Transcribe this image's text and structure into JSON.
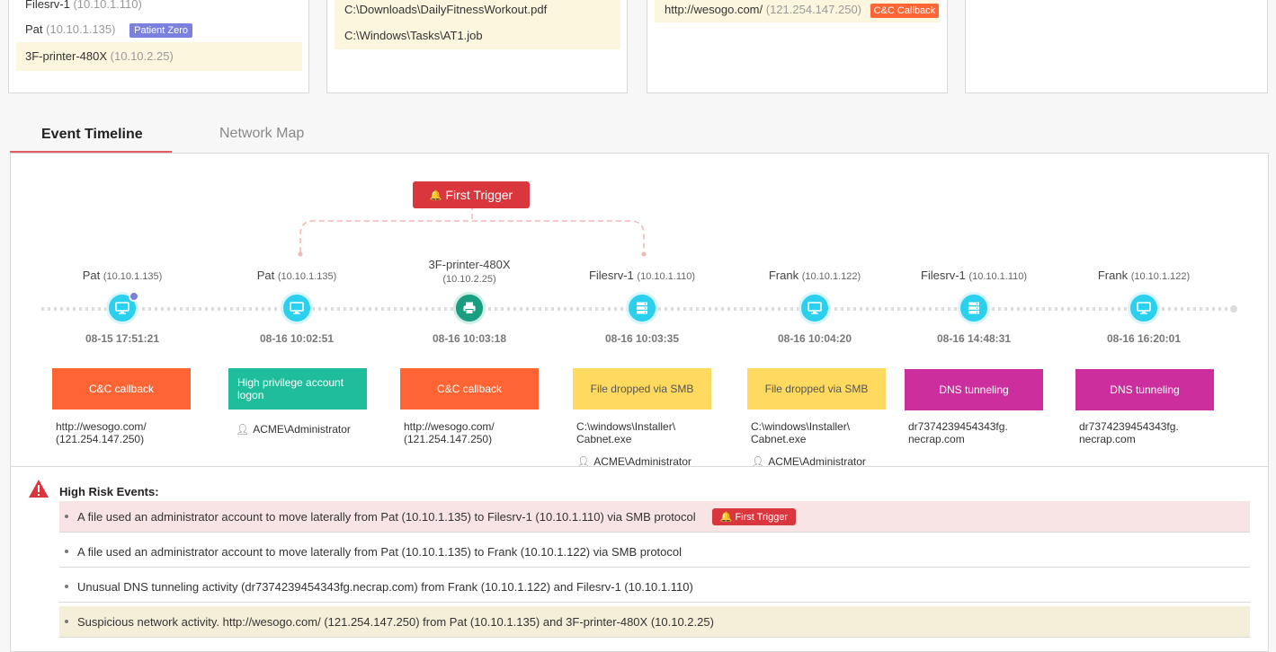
{
  "cards": {
    "hosts": [
      {
        "name": "Filesrv-1",
        "ip": "(10.10.1.110)"
      },
      {
        "name": "Pat",
        "ip": "(10.10.1.135)",
        "badge": "Patient Zero"
      },
      {
        "name": "3F-printer-480X",
        "ip": "(10.10.2.25)"
      }
    ],
    "files": [
      "C:\\Downloads\\DailyFitnessWorkout.pdf",
      "C:\\Windows\\Tasks\\AT1.job"
    ],
    "urls": [
      {
        "url": "http://wesogo.com/",
        "ip": "(121.254.147.250)",
        "badge": "C&C Callback"
      }
    ]
  },
  "tabs": {
    "timeline": "Event Timeline",
    "network": "Network Map"
  },
  "first_trigger": "First Trigger",
  "events": [
    {
      "host": "Pat",
      "ip": "(10.10.1.135)",
      "time": "08-15 17:51:21",
      "icon": "monitor-icon",
      "tag": "C&C callback",
      "color": "#ff6534",
      "detail": "http://wesogo.com/\n(121.254.147.250)",
      "user": ""
    },
    {
      "host": "Pat",
      "ip": "(10.10.1.135)",
      "time": "08-16 10:02:51",
      "icon": "monitor-icon",
      "tag": "High privilege account logon",
      "color": "#1fbd9c",
      "detail": "",
      "user": "ACME\\Administrator"
    },
    {
      "host": "3F-printer-480X",
      "ip": "(10.10.2.25)",
      "time": "08-16 10:03:18",
      "icon": "printer-icon",
      "tag": "C&C callback",
      "color": "#ff6534",
      "detail": "http://wesogo.com/\n(121.254.147.250)",
      "user": ""
    },
    {
      "host": "Filesrv-1",
      "ip": "(10.10.1.110)",
      "time": "08-16 10:03:35",
      "icon": "server-icon",
      "tag": "File dropped via SMB",
      "color": "#ffda5f",
      "detail": "C:\\windows\\Installer\\\nCabnet.exe",
      "user": "ACME\\Administrator"
    },
    {
      "host": "Frank",
      "ip": "(10.10.1.122)",
      "time": "08-16 10:04:20",
      "icon": "monitor-icon",
      "tag": "File dropped via SMB",
      "color": "#ffda5f",
      "detail": "C:\\windows\\Installer\\\nCabnet.exe",
      "user": "ACME\\Administrator"
    },
    {
      "host": "Filesrv-1",
      "ip": "(10.10.1.110)",
      "time": "08-16 14:48:31",
      "icon": "server-icon",
      "tag": "DNS tunneling",
      "color": "#cc2f9d",
      "detail": "dr7374239454343fg.\nnecrap.com",
      "user": ""
    },
    {
      "host": "Frank",
      "ip": "(10.10.1.122)",
      "time": "08-16 16:20:01",
      "icon": "monitor-icon",
      "tag": "DNS tunneling",
      "color": "#cc2f9d",
      "detail": "dr7374239454343fg.\nnecrap.com",
      "user": ""
    }
  ],
  "risk": {
    "title": "High Risk Events:",
    "items": [
      {
        "text": "A file used an administrator account to move laterally from Pat (10.10.1.135) to Filesrv-1 (10.10.1.110) via SMB protocol",
        "badge": "First Trigger",
        "bg": "#f8e4e4"
      },
      {
        "text": "A file used an administrator account to move laterally from Pat (10.10.1.135) to Frank (10.10.1.122) via SMB protocol",
        "badge": "",
        "bg": "#ffffff"
      },
      {
        "text": "Unusual DNS tunneling activity (dr7374239454343fg.necrap.com) from Frank (10.10.1.122) and Filesrv-1 (10.10.1.110)",
        "badge": "",
        "bg": "#ffffff"
      },
      {
        "text": "Suspicious network activity. http://wesogo.com/ (121.254.147.250) from Pat (10.10.1.135) and 3F-printer-480X (10.10.2.25)",
        "badge": "",
        "bg": "#f5efda"
      }
    ]
  }
}
